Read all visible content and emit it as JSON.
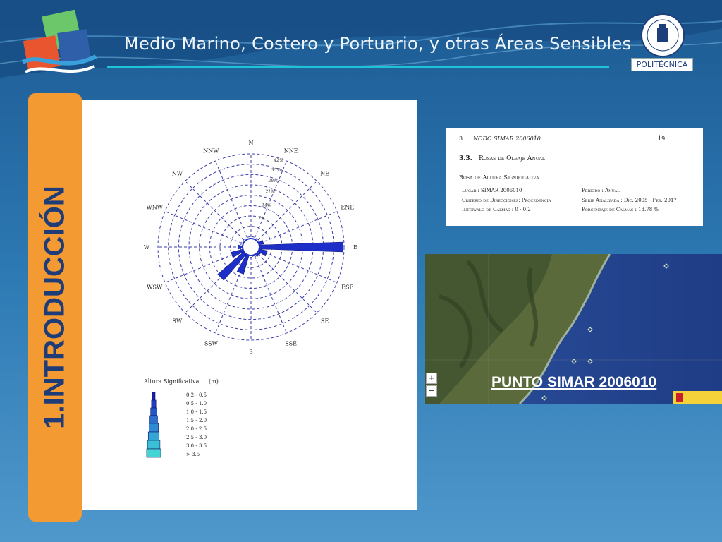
{
  "header": {
    "title": "Medio Marino, Costero y Portuario, y otras Áreas Sensibles",
    "institution_label": "POLITÉCNICA"
  },
  "sidebar": {
    "section_title": "1.INTRODUCCIÓN"
  },
  "wind_rose": {
    "directions": [
      "N",
      "NNE",
      "NE",
      "ENE",
      "E",
      "ESE",
      "SE",
      "SSE",
      "S",
      "SSW",
      "SW",
      "WSW",
      "W",
      "WNW",
      "NW",
      "NNW"
    ],
    "rings": [
      "7%",
      "14%",
      "21%",
      "28%",
      "35%",
      "42%"
    ],
    "legend_title": "Altura Significativa",
    "legend_unit": "(m)",
    "legend_items": [
      "0.2 - 0.5",
      "0.5 - 1.0",
      "1.0 - 1.5",
      "1.5 - 2.0",
      "2.0 - 2.5",
      "2.5 - 3.0",
      "3.0 - 3.5",
      "> 3.5"
    ]
  },
  "doc": {
    "chapter_num": "3",
    "chapter_title": "NODO SIMAR 2006010",
    "page_num": "19",
    "section_num": "3.3.",
    "section_title": "Rosas de Oleaje Anual",
    "subsection": "Rosa de Altura Significativa",
    "lugar": "Lugar : SIMAR 2006010",
    "periodo": "Periodo : Anual",
    "criterio": "Criterio de Direcciones: Procedencia",
    "serie": "Serie Analizada : Dic. 2005 - Feb. 2017",
    "intervalo": "Intervalo de Calmas : 0 - 0.2",
    "porcentaje": "Porcentaje de Calmas : 13.78 %"
  },
  "map": {
    "label": "PUNTO SIMAR 2006010",
    "zoom_in": "+",
    "zoom_out": "−"
  },
  "colors": {
    "accent_orange": "#f49a32",
    "title_navy": "#1e3c78",
    "header_line": "#1fc3d6"
  }
}
